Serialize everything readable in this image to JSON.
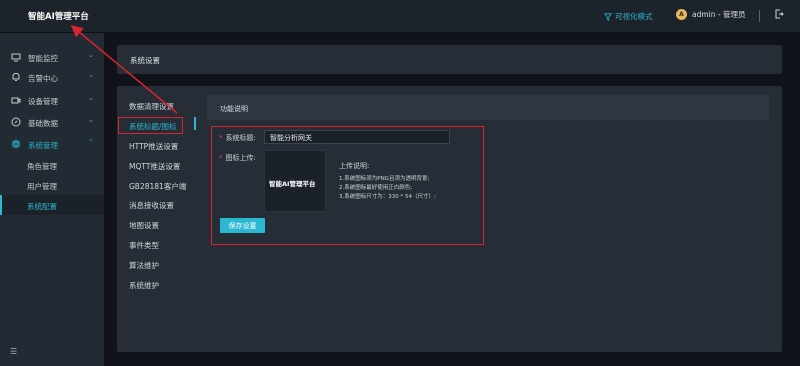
{
  "header": {
    "app_title": "智能AI管理平台",
    "viz_mode": "可视化模式",
    "avatar_letter": "A",
    "user": "admin - 管理员"
  },
  "sidebar": {
    "items": [
      {
        "label": "智能监控",
        "icon": "monitor-icon"
      },
      {
        "label": "告警中心",
        "icon": "bell-icon"
      },
      {
        "label": "设备管理",
        "icon": "camera-icon"
      },
      {
        "label": "基础数据",
        "icon": "compass-icon"
      },
      {
        "label": "系统管理",
        "icon": "gear-icon"
      }
    ],
    "sub_items": [
      "角色管理",
      "用户管理",
      "系统配置"
    ]
  },
  "page": {
    "title": "系统设置"
  },
  "settings_nav": [
    "数据清理设置",
    "系统标题/图标",
    "HTTP推送设置",
    "MQTT推送设置",
    "GB28181客户端",
    "消息接收设置",
    "地图设置",
    "事件类型",
    "算法维护",
    "系统维护"
  ],
  "section": {
    "title": "功能说明"
  },
  "form": {
    "title_label": "系统标题:",
    "title_value": "智能分析网关",
    "icon_label": "图标上传:",
    "preview_text": "智能AI管理平台",
    "upload_notes_title": "上传说明:",
    "upload_notes": [
      "1.系统图标须为PNG且须为透明背景;",
      "2.系统图标最好使用正白颜色;",
      "3.系统图标尺寸为：330 * 54（尺寸）;"
    ],
    "save_label": "保存设置"
  },
  "colors": {
    "accent": "#2bb8d1",
    "annotation": "#d6252f"
  }
}
